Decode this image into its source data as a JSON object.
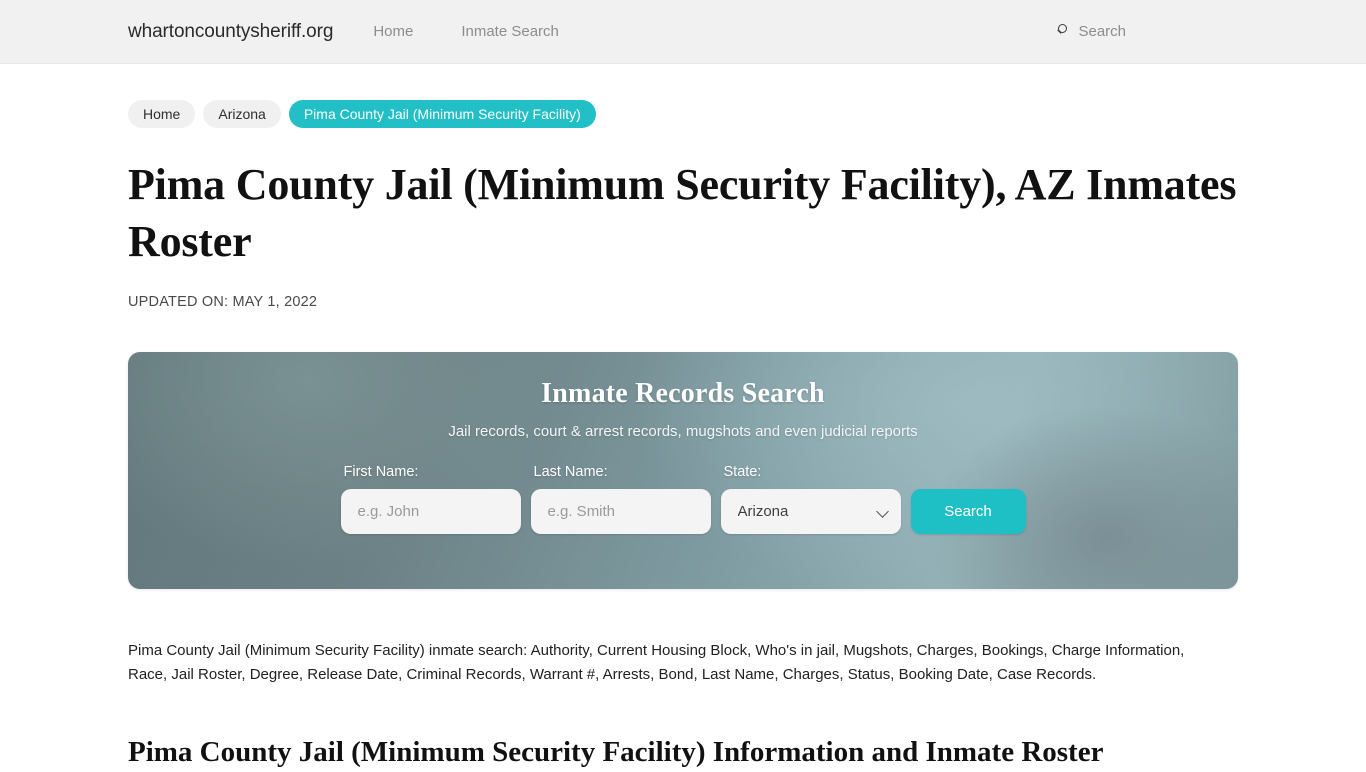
{
  "header": {
    "brand": "whartoncountysheriff.org",
    "nav": [
      {
        "label": "Home"
      },
      {
        "label": "Inmate Search"
      }
    ],
    "search": {
      "icon": "search-icon",
      "label": "Search"
    }
  },
  "breadcrumb": [
    {
      "label": "Home",
      "active": false
    },
    {
      "label": "Arizona",
      "active": false
    },
    {
      "label": "Pima County Jail (Minimum Security Facility)",
      "active": true
    }
  ],
  "main": {
    "title": "Pima County Jail (Minimum Security Facility), AZ Inmates Roster",
    "updated": "UPDATED ON: MAY 1, 2022",
    "intro": "Pima County Jail (Minimum Security Facility) inmate search: Authority, Current Housing Block, Who's in jail, Mugshots, Charges, Bookings, Charge Information, Race, Jail Roster, Degree, Release Date, Criminal Records, Warrant #, Arrests, Bond, Last Name, Charges, Status, Booking Date, Case Records.",
    "section_heading": "Pima County Jail (Minimum Security Facility) Information and Inmate Roster"
  },
  "search_panel": {
    "title": "Inmate Records Search",
    "subtitle": "Jail records, court & arrest records, mugshots and even judicial reports",
    "first_name": {
      "label": "First Name:",
      "placeholder": "e.g. John",
      "value": ""
    },
    "last_name": {
      "label": "Last Name:",
      "placeholder": "e.g. Smith",
      "value": ""
    },
    "state": {
      "label": "State:",
      "selected": "Arizona",
      "options": [
        "Arizona"
      ]
    },
    "submit_label": "Search"
  },
  "colors": {
    "accent_teal": "#1fbfc6",
    "breadcrumb_active": "#22bfc7",
    "panel_gradient_dark": "#62787c",
    "panel_gradient_light": "#92b0b5",
    "header_bg": "#f1f1f1",
    "nav_text": "#8d8d8d"
  }
}
